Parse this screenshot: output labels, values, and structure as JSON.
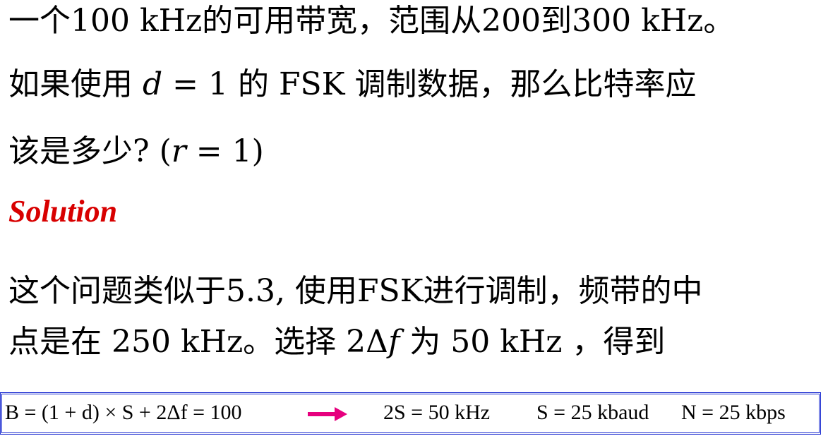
{
  "question": {
    "line1": "一个100  kHz的可用带宽，范围从200到300  kHz。",
    "line2_a": "如果使用 ",
    "line2_var": "d",
    "line2_b": " = 1 的 FSK 调制数据，那么比特率应",
    "line3_a": "该是多少? (",
    "line3_var": "r",
    "line3_b": " = 1)"
  },
  "solution_heading": "Solution",
  "solution": {
    "line1": "这个问题类似于5.3,   使用FSK进行调制，频带的中",
    "line2_a": "点是在 250 kHz。选择 2Δ",
    "line2_var": "f",
    "line2_b": " 为 50 kHz ，得到"
  },
  "equation": {
    "formula": "B = (1 + d) × S  + 2Δf  = 100",
    "result1": "2S = 50 kHz",
    "result2": "S = 25 kbaud",
    "result3": "N = 25 kbps",
    "arrow_color": "#e6007e",
    "border_color": "#1a2bd0"
  }
}
